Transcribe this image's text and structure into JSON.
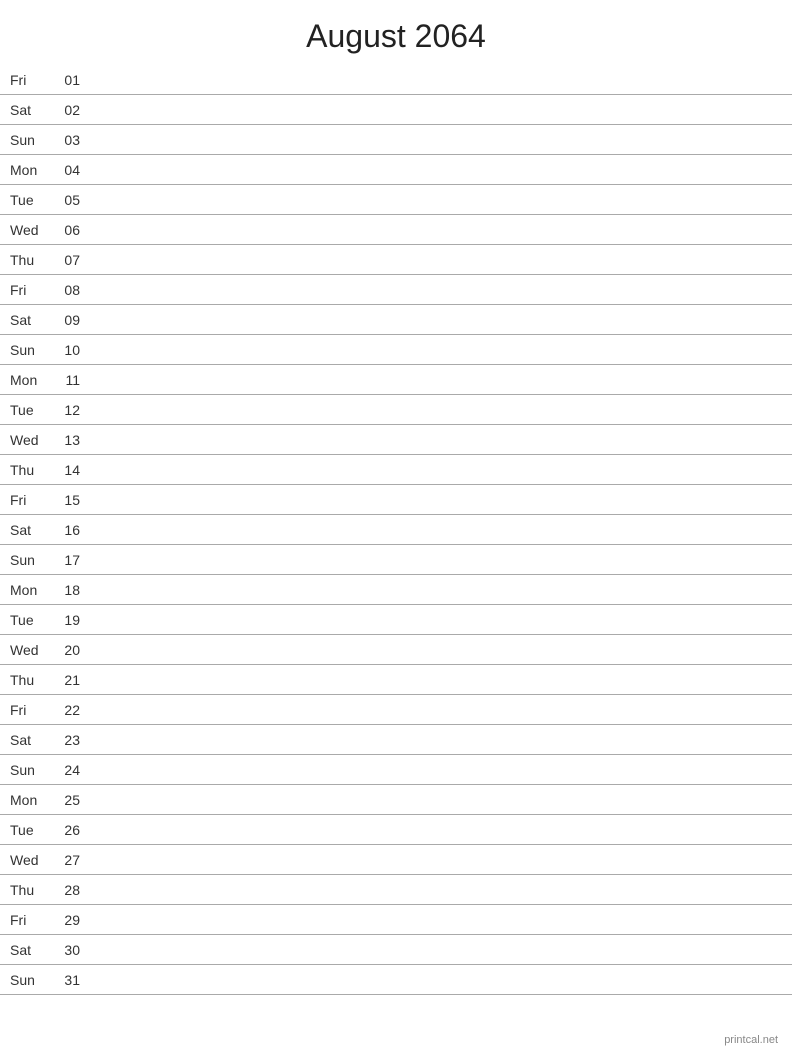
{
  "title": "August 2064",
  "footer": "printcal.net",
  "days": [
    {
      "name": "Fri",
      "number": "01"
    },
    {
      "name": "Sat",
      "number": "02"
    },
    {
      "name": "Sun",
      "number": "03"
    },
    {
      "name": "Mon",
      "number": "04"
    },
    {
      "name": "Tue",
      "number": "05"
    },
    {
      "name": "Wed",
      "number": "06"
    },
    {
      "name": "Thu",
      "number": "07"
    },
    {
      "name": "Fri",
      "number": "08"
    },
    {
      "name": "Sat",
      "number": "09"
    },
    {
      "name": "Sun",
      "number": "10"
    },
    {
      "name": "Mon",
      "number": "11"
    },
    {
      "name": "Tue",
      "number": "12"
    },
    {
      "name": "Wed",
      "number": "13"
    },
    {
      "name": "Thu",
      "number": "14"
    },
    {
      "name": "Fri",
      "number": "15"
    },
    {
      "name": "Sat",
      "number": "16"
    },
    {
      "name": "Sun",
      "number": "17"
    },
    {
      "name": "Mon",
      "number": "18"
    },
    {
      "name": "Tue",
      "number": "19"
    },
    {
      "name": "Wed",
      "number": "20"
    },
    {
      "name": "Thu",
      "number": "21"
    },
    {
      "name": "Fri",
      "number": "22"
    },
    {
      "name": "Sat",
      "number": "23"
    },
    {
      "name": "Sun",
      "number": "24"
    },
    {
      "name": "Mon",
      "number": "25"
    },
    {
      "name": "Tue",
      "number": "26"
    },
    {
      "name": "Wed",
      "number": "27"
    },
    {
      "name": "Thu",
      "number": "28"
    },
    {
      "name": "Fri",
      "number": "29"
    },
    {
      "name": "Sat",
      "number": "30"
    },
    {
      "name": "Sun",
      "number": "31"
    }
  ]
}
